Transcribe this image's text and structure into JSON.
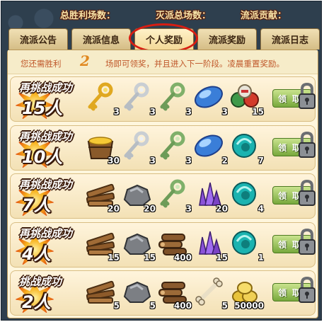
{
  "stats": {
    "wins_label": "总胜利场数：",
    "total_battles_label": "灭派总场数：",
    "contribution_label": "流派贡献："
  },
  "tabs": [
    {
      "label": "流派公告",
      "active": false
    },
    {
      "label": "流派信息",
      "active": false
    },
    {
      "label": "个人奖励",
      "active": true
    },
    {
      "label": "流派奖励",
      "active": false
    },
    {
      "label": "流派日志",
      "active": false
    }
  ],
  "notice": {
    "prefix": "您还需胜利",
    "count": "2",
    "suffix": "场即可领奖，并且进入下一阶段。凌晨重置奖励。"
  },
  "claim_label": "领取",
  "rows": [
    {
      "title": "再挑战成功",
      "count": "15人",
      "items": [
        {
          "icon": "gold-key-icon",
          "qty": "3"
        },
        {
          "icon": "silver-key-icon",
          "qty": "3"
        },
        {
          "icon": "jade-key-icon",
          "qty": "3"
        },
        {
          "icon": "blue-gem-icon",
          "qty": "3"
        },
        {
          "icon": "potion-jars-icon",
          "qty": "15"
        }
      ]
    },
    {
      "title": "再挑战成功",
      "count": "10人",
      "items": [
        {
          "icon": "gold-tub-icon",
          "qty": "30"
        },
        {
          "icon": "silver-key-icon",
          "qty": "3"
        },
        {
          "icon": "jade-key-icon",
          "qty": "3"
        },
        {
          "icon": "blue-gem-icon",
          "qty": "2"
        },
        {
          "icon": "teal-orb-icon",
          "qty": "7"
        }
      ]
    },
    {
      "title": "再挑战成功",
      "count": "7人",
      "items": [
        {
          "icon": "wood-planks-icon",
          "qty": "20"
        },
        {
          "icon": "stone-icon",
          "qty": "20"
        },
        {
          "icon": "jade-key-icon",
          "qty": "3"
        },
        {
          "icon": "purple-crystal-icon",
          "qty": "20"
        },
        {
          "icon": "teal-orb-icon",
          "qty": "4"
        }
      ]
    },
    {
      "title": "再挑战成功",
      "count": "4人",
      "items": [
        {
          "icon": "wood-planks-icon",
          "qty": "15"
        },
        {
          "icon": "stone-icon",
          "qty": "15"
        },
        {
          "icon": "logs-icon",
          "qty": "400"
        },
        {
          "icon": "purple-crystal-icon",
          "qty": "15"
        },
        {
          "icon": "teal-orb-icon",
          "qty": "1"
        }
      ]
    },
    {
      "title": "挑战成功",
      "count": "2人",
      "items": [
        {
          "icon": "wood-planks-icon",
          "qty": "5"
        },
        {
          "icon": "stone-icon",
          "qty": "5"
        },
        {
          "icon": "logs-icon",
          "qty": "400"
        },
        {
          "icon": "bone-icon",
          "qty": "5"
        },
        {
          "icon": "gold-coins-icon",
          "qty": "50000"
        }
      ]
    }
  ],
  "colors": {
    "accent_red": "#d81d12",
    "notice_text": "#c0582b",
    "claim_green": "#77a83c"
  }
}
